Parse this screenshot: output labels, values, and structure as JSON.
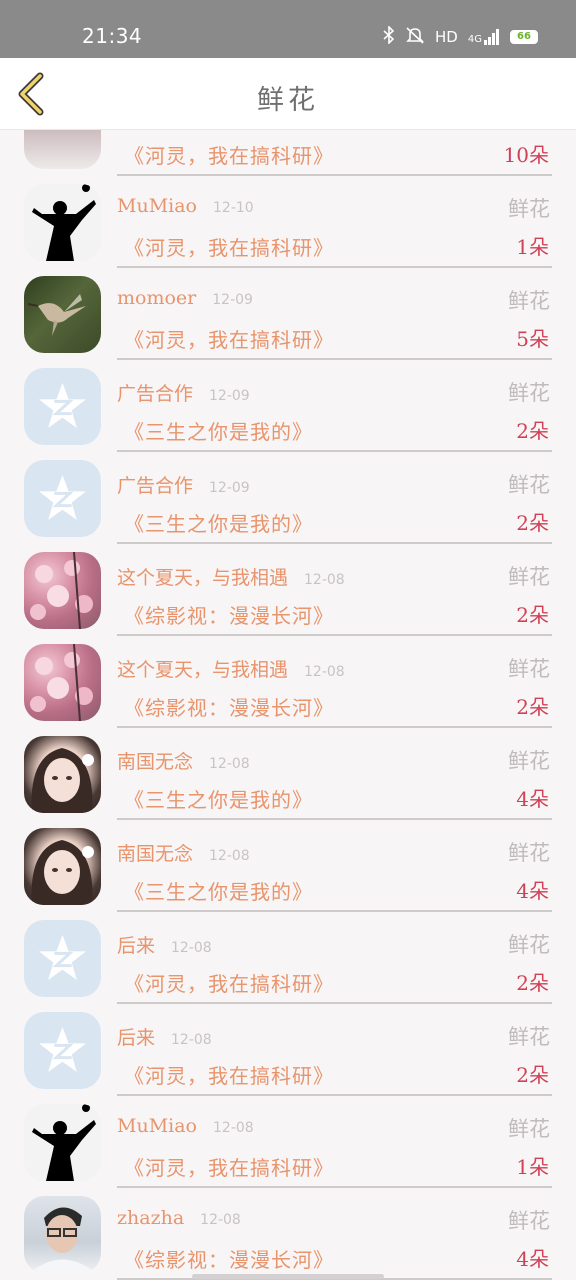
{
  "status_bar": {
    "time": "21:34",
    "network": "HD",
    "signal_label": "4G",
    "battery": "66"
  },
  "header": {
    "title": "鲜花"
  },
  "rows": [
    {
      "name": "",
      "date": "",
      "kind": "",
      "work": "《河灵，我在搞科研》",
      "count": "10朵",
      "avatar": "flower-light"
    },
    {
      "name": "MuMiao",
      "date": "12-10",
      "kind": "鲜花",
      "work": "《河灵，我在搞科研》",
      "count": "1朵",
      "avatar": "silhouette"
    },
    {
      "name": "momoer",
      "date": "12-09",
      "kind": "鲜花",
      "work": "《河灵，我在搞科研》",
      "count": "5朵",
      "avatar": "bird"
    },
    {
      "name": "广告合作",
      "date": "12-09",
      "kind": "鲜花",
      "work": "《三生之你是我的》",
      "count": "2朵",
      "avatar": "default-star"
    },
    {
      "name": "广告合作",
      "date": "12-09",
      "kind": "鲜花",
      "work": "《三生之你是我的》",
      "count": "2朵",
      "avatar": "default-star"
    },
    {
      "name": "这个夏天，与我相遇",
      "date": "12-08",
      "kind": "鲜花",
      "work": "《综影视：漫漫长河》",
      "count": "2朵",
      "avatar": "flower"
    },
    {
      "name": "这个夏天，与我相遇",
      "date": "12-08",
      "kind": "鲜花",
      "work": "《综影视：漫漫长河》",
      "count": "2朵",
      "avatar": "flower"
    },
    {
      "name": "南国无念",
      "date": "12-08",
      "kind": "鲜花",
      "work": "《三生之你是我的》",
      "count": "4朵",
      "avatar": "girl"
    },
    {
      "name": "南国无念",
      "date": "12-08",
      "kind": "鲜花",
      "work": "《三生之你是我的》",
      "count": "4朵",
      "avatar": "girl"
    },
    {
      "name": "后来",
      "date": "12-08",
      "kind": "鲜花",
      "work": "《河灵，我在搞科研》",
      "count": "2朵",
      "avatar": "default-star"
    },
    {
      "name": "后来",
      "date": "12-08",
      "kind": "鲜花",
      "work": "《河灵，我在搞科研》",
      "count": "2朵",
      "avatar": "default-star"
    },
    {
      "name": "MuMiao",
      "date": "12-08",
      "kind": "鲜花",
      "work": "《河灵，我在搞科研》",
      "count": "1朵",
      "avatar": "silhouette"
    },
    {
      "name": "zhazha",
      "date": "12-08",
      "kind": "鲜花",
      "work": "《综影视：漫漫长河》",
      "count": "4朵",
      "avatar": "man"
    }
  ]
}
